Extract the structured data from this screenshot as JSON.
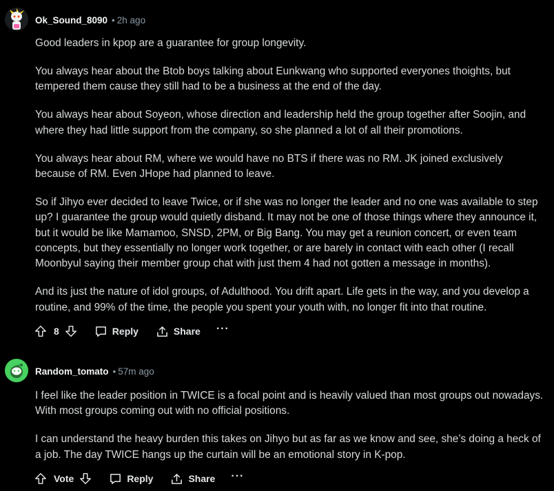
{
  "comments": [
    {
      "username": "Ok_Sound_8090",
      "separator": "•",
      "time": "2h ago",
      "paragraphs": [
        "Good leaders in kpop are a guarantee for group longevity.",
        "You always hear about the Btob boys talking about Eunkwang who supported everyones thoights, but tempered them cause they still had to be a business at the end of the day.",
        "You always hear about Soyeon, whose direction and leadership held the group together after Soojin, and where they had little support from the company, so she planned a lot of all their promotions.",
        "You always hear about RM, where we would have no BTS if there was no RM. JK joined exclusively because of RM. Even JHope had planned to leave.",
        "So if Jihyo ever decided to leave Twice, or if she was no longer the leader and no one was available to step up? I guarantee the group would quietly disband. It may not be one of those things where they announce it, but it would be like Mamamoo, SNSD, 2PM, or Big Bang. You may get a reunion concert, or even team concepts, but they essentially no longer work together, or are barely in contact with each other (I recall Moonbyul saying their member group chat with just them 4 had not gotten a message in months).",
        "And its just the nature of idol groups, of Adulthood. You drift apart. Life gets in the way, and you develop a routine, and 99% of the time, the people you spent your youth with, no longer fit into that routine."
      ],
      "vote_label": "8",
      "reply_label": "Reply",
      "share_label": "Share",
      "more_label": "···"
    },
    {
      "username": "Random_tomato",
      "separator": "•",
      "time": "57m ago",
      "paragraphs": [
        "I feel like the leader position in TWICE is a focal point and is heavily valued than most groups out nowadays. With most groups coming out with no official positions.",
        "I can understand the heavy burden this takes on Jihyo but as far as we know and see, she’s doing a heck of a job. The day TWICE hangs up the curtain will be an emotional story in K-pop."
      ],
      "vote_label": "Vote",
      "reply_label": "Reply",
      "share_label": "Share",
      "more_label": "···"
    }
  ],
  "colors": {
    "background": "#000000",
    "text": "#d7dadc",
    "meta": "#8a9aa4",
    "avatar2": "#46d160"
  },
  "icons": {
    "upvote": "upvote-arrow-icon",
    "downvote": "downvote-arrow-icon",
    "reply": "speech-bubble-icon",
    "share": "share-upload-icon",
    "more": "ellipsis-icon"
  }
}
